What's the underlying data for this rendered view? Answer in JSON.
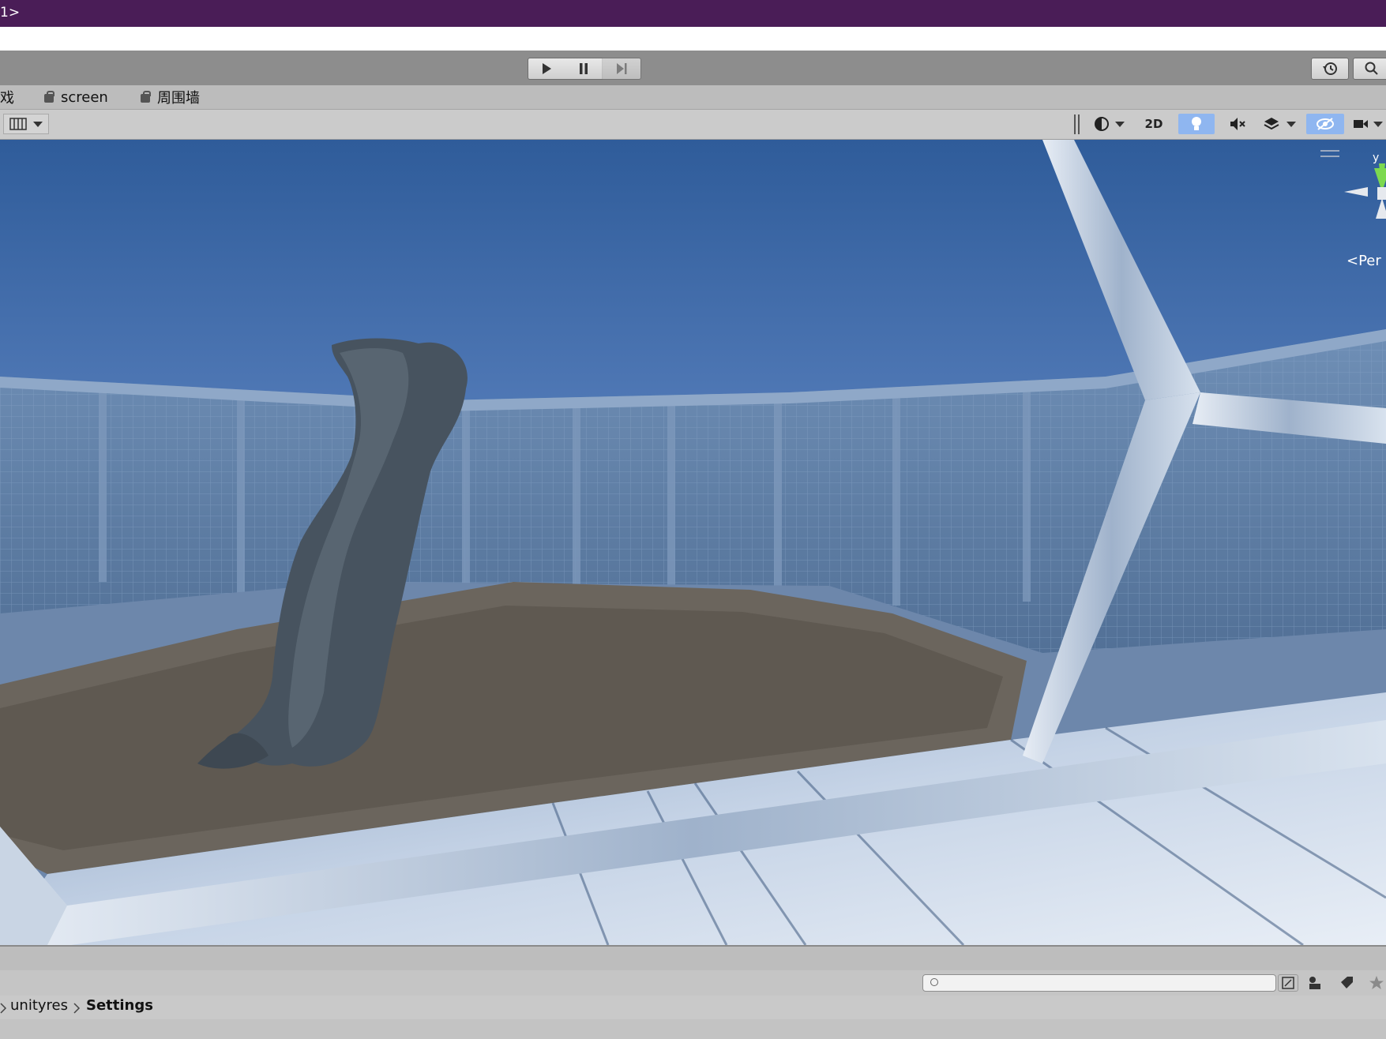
{
  "window": {
    "title_fragment": "1>"
  },
  "playmode": {
    "play_icon": "play-icon",
    "pause_icon": "pause-icon",
    "step_icon": "step-icon",
    "history_icon": "history-icon",
    "search_icon": "search-icon"
  },
  "tabs": [
    {
      "label": "戏"
    },
    {
      "label": "screen",
      "icon": "prefab-icon"
    },
    {
      "label": "周围墙",
      "icon": "prefab-icon"
    }
  ],
  "scene_toolbar": {
    "left_icon": "ruler-grid-icon",
    "shading_icon": "shading-sphere-icon",
    "mode_2d_label": "2D",
    "lighting_icon": "lightbulb-icon",
    "lighting_active": true,
    "audio_icon": "audio-mute-icon",
    "effects_icon": "effects-layers-icon",
    "hidden_icon": "scene-visibility-icon",
    "hidden_active": true,
    "camera_icon": "camera-icon"
  },
  "gizmo": {
    "axis_y_label": "y",
    "projection_label": "<Per"
  },
  "project": {
    "search_placeholder": "",
    "breadcrumb": [
      "unityres",
      "Settings"
    ]
  },
  "colors": {
    "titlebar": "#4a1d57",
    "toolbar": "#8d8d8d",
    "active_toggle": "#8fb6f0",
    "sky_top": "#2f5c9a",
    "sky_horizon": "#8fb0d8"
  }
}
